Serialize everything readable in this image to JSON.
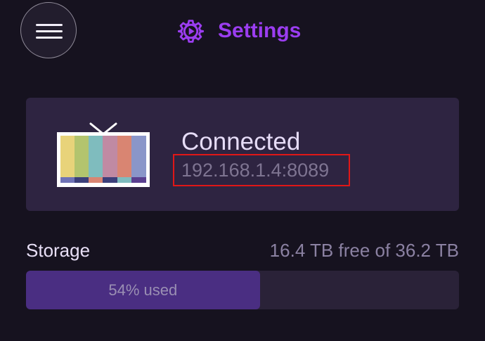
{
  "colors": {
    "accent": "#9b3df0",
    "background": "#16121f",
    "card": "#2e2441",
    "highlight_border": "#e01717"
  },
  "header": {
    "menu_icon": "hamburger-menu-icon",
    "title_icon": "gear-play-icon",
    "title": "Settings"
  },
  "connection": {
    "icon": "tv-color-bars-icon",
    "status": "Connected",
    "address": "192.168.1.4:8089"
  },
  "storage": {
    "label": "Storage",
    "summary": "16.4 TB free of 36.2 TB",
    "used_fraction": 0.54,
    "used_label": "54% used"
  }
}
